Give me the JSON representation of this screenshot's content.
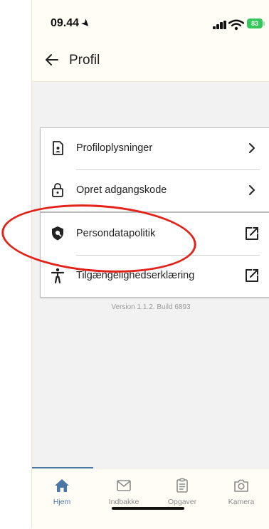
{
  "status_bar": {
    "time": "09.44",
    "battery": "83"
  },
  "header": {
    "title": "Profil"
  },
  "settings": {
    "group1": [
      {
        "label": "Profiloplysninger",
        "icon": "id-card-icon",
        "trail": "chevron-right-icon"
      },
      {
        "label": "Opret adgangskode",
        "icon": "lock-icon",
        "trail": "chevron-right-icon"
      }
    ],
    "group2": [
      {
        "label": "Persondatapolitik",
        "icon": "shield-icon",
        "trail": "external-link-icon"
      },
      {
        "label": "Tilgængelighedserklæring",
        "icon": "accessibility-icon",
        "trail": "external-link-icon"
      }
    ]
  },
  "version": "Version 1.1.2. Build 6893",
  "tabs": [
    {
      "label": "Hjem",
      "icon": "home-icon",
      "active": true
    },
    {
      "label": "Indbakke",
      "icon": "inbox-icon",
      "active": false
    },
    {
      "label": "Opgaver",
      "icon": "clipboard-icon",
      "active": false
    },
    {
      "label": "Kamera",
      "icon": "camera-icon",
      "active": false
    }
  ],
  "colors": {
    "accent": "#4a77a6",
    "annotation": "#e2231a",
    "battery": "#34c759"
  }
}
